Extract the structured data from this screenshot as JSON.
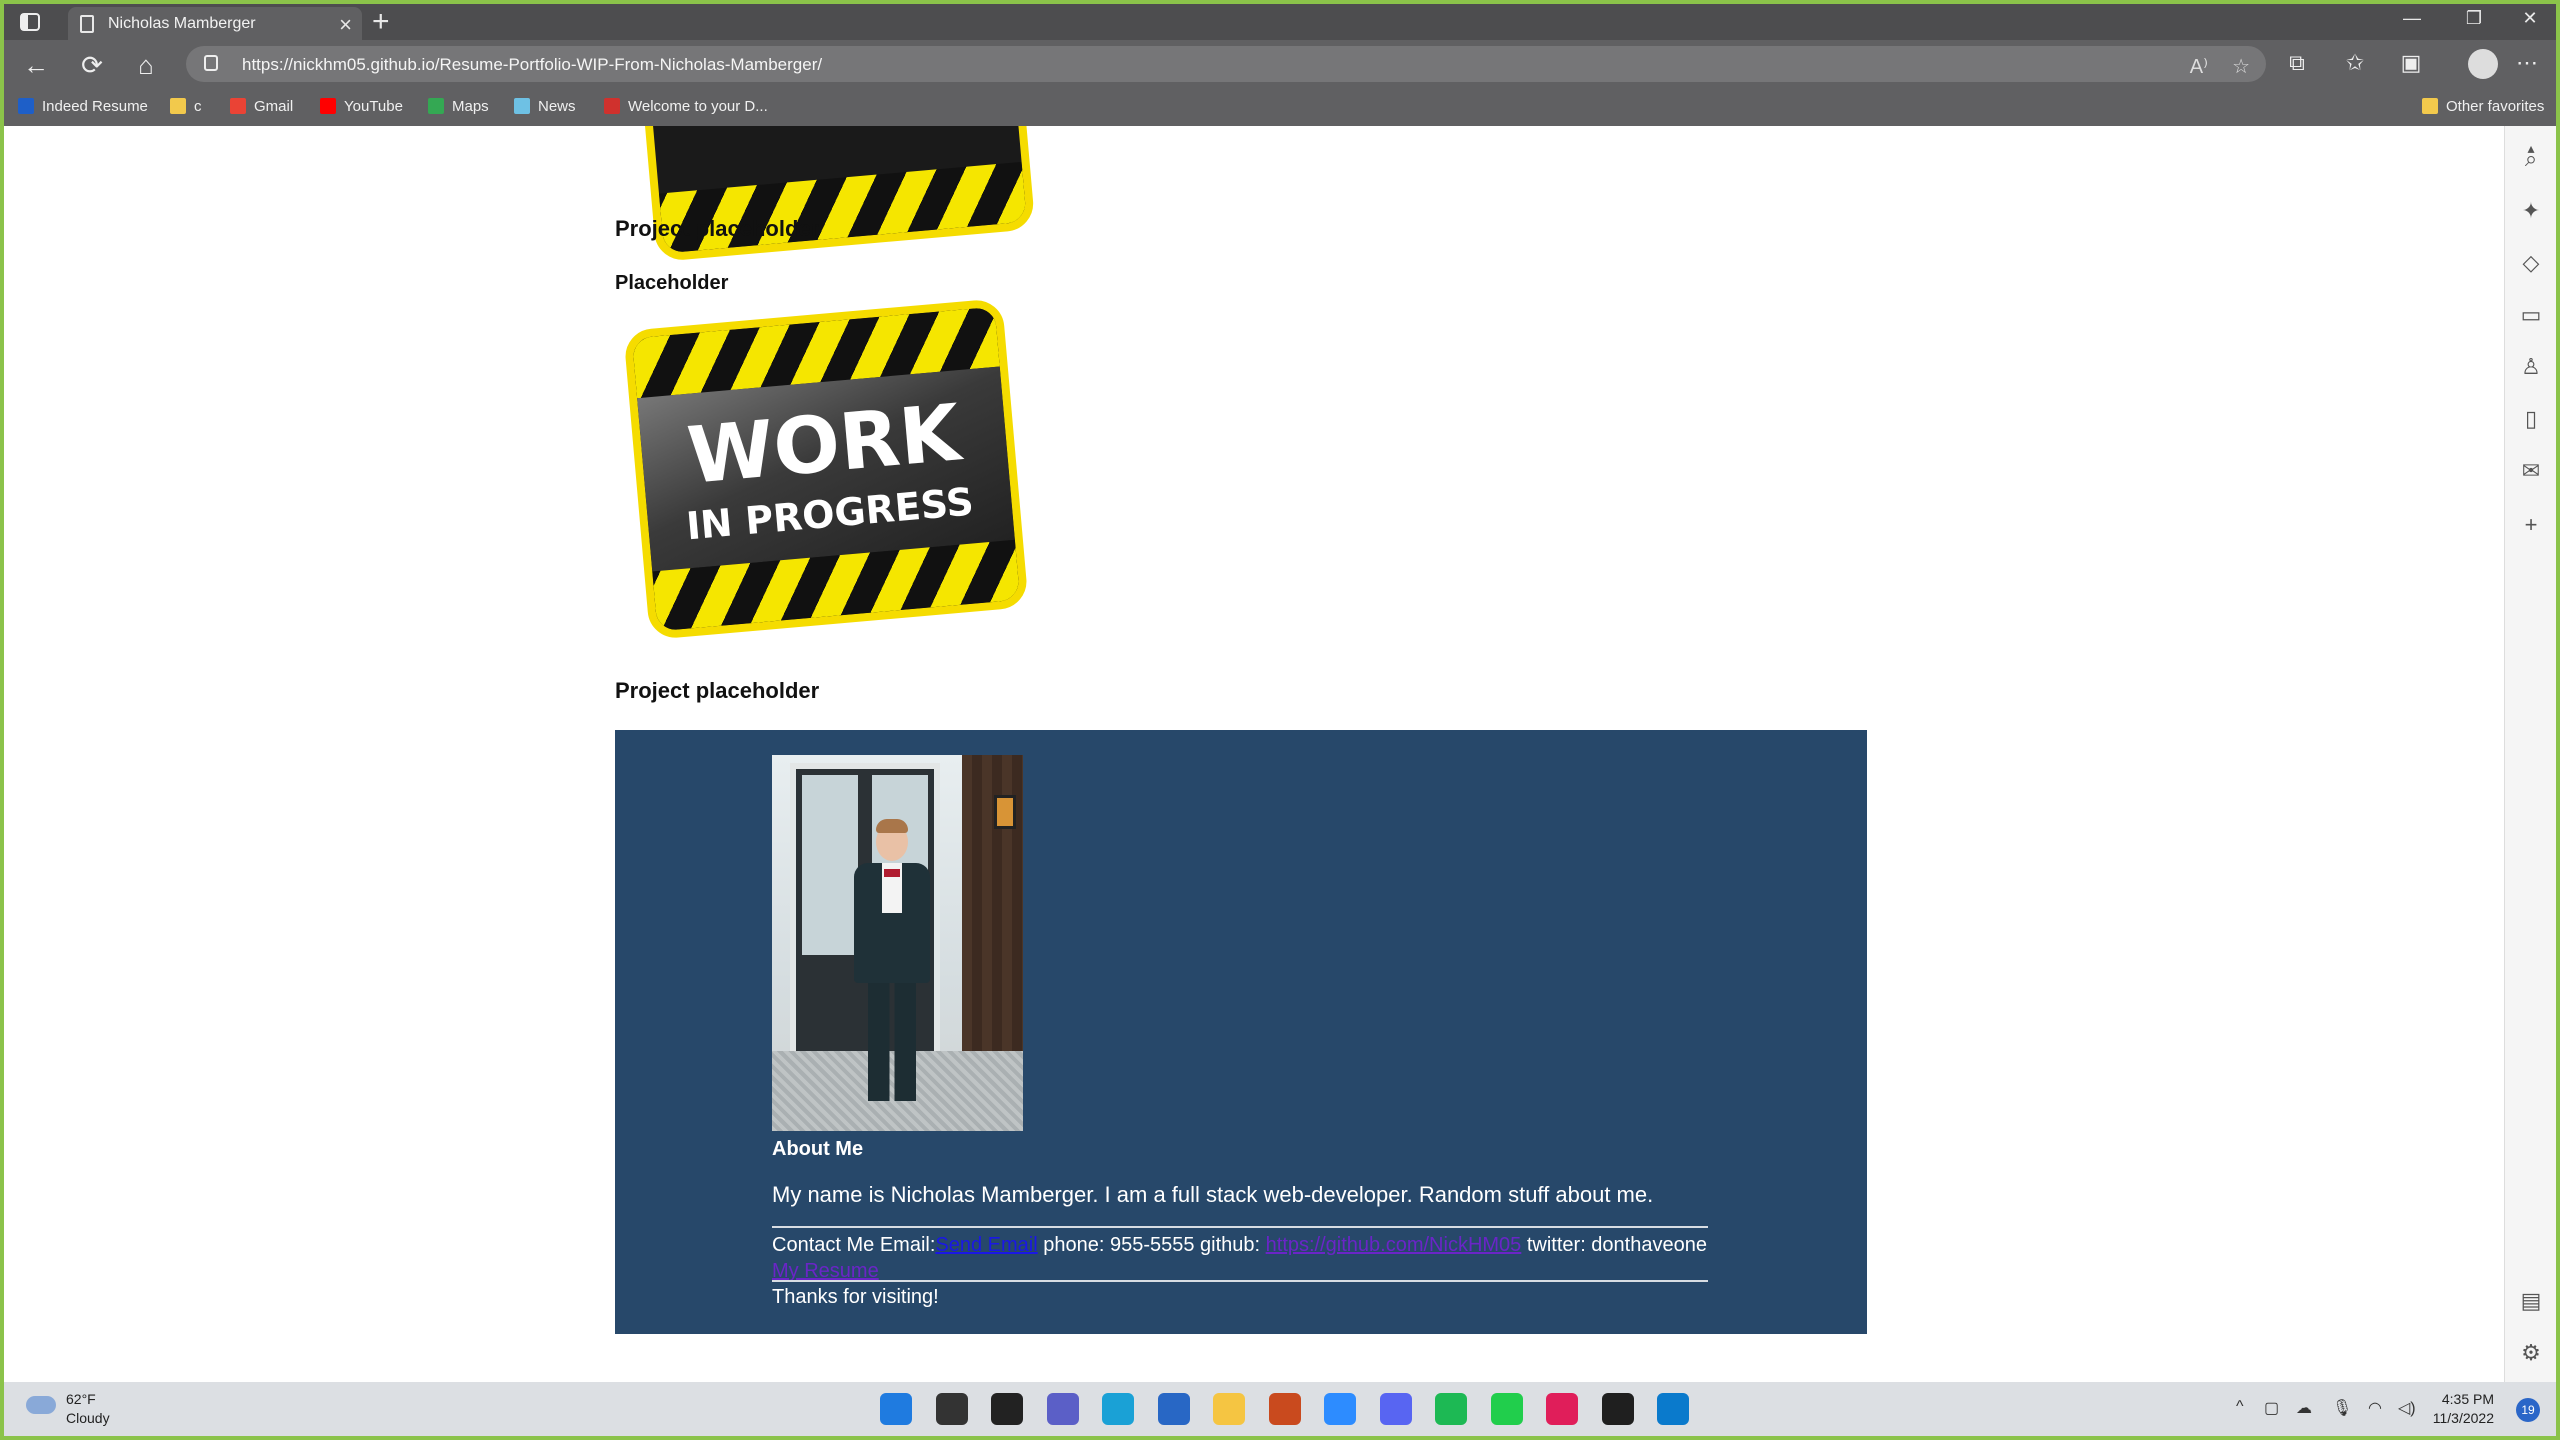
{
  "browser": {
    "tab_title": "Nicholas Mamberger",
    "url": "https://nickhm05.github.io/Resume-Portfolio-WIP-From-Nicholas-Mamberger/",
    "favorites": [
      {
        "label": "Indeed Resume",
        "icon": "indeed-icon",
        "color": "#1e5fc8"
      },
      {
        "label": "c",
        "icon": "folder-icon",
        "color": "#f2c94c"
      },
      {
        "label": "Gmail",
        "icon": "gmail-icon",
        "color": "#ea4335"
      },
      {
        "label": "YouTube",
        "icon": "youtube-icon",
        "color": "#ff0000"
      },
      {
        "label": "Maps",
        "icon": "maps-icon",
        "color": "#34a853"
      },
      {
        "label": "News",
        "icon": "news-icon",
        "color": "#6ec1e4"
      },
      {
        "label": "Welcome to your D...",
        "icon": "page-icon",
        "color": "#d0312d"
      }
    ],
    "other_favorites": "Other favorites"
  },
  "page": {
    "project_heading_1": "Project placeholder",
    "placeholder_heading": "Placeholder",
    "wip_word_1": "WORK",
    "wip_word_2": "IN PROGRESS",
    "project_heading_2": "Project placeholder",
    "about": {
      "title": "About Me",
      "text": "My name is Nicholas Mamberger. I am a full stack web-developer. Random stuff about me.",
      "contact_prefix": "Contact Me Email:",
      "email_link": "Send Email",
      "phone": " phone: 955-5555 github: ",
      "github_link": "https://github.com/NickHM05",
      "twitter": " twitter: donthaveone",
      "resume_link": "My Resume",
      "thanks": "Thanks for visiting!"
    }
  },
  "taskbar": {
    "temp": "62°F",
    "condition": "Cloudy",
    "time": "4:35 PM",
    "date": "11/3/2022",
    "notifications": "19",
    "apps": [
      {
        "name": "start-icon",
        "color": "#1f7be0"
      },
      {
        "name": "search-icon",
        "color": "#333333"
      },
      {
        "name": "task-view-icon",
        "color": "#222222"
      },
      {
        "name": "teams-chat-icon",
        "color": "#5b5fc7"
      },
      {
        "name": "edge-icon",
        "color": "#1aa1d6"
      },
      {
        "name": "store-icon",
        "color": "#2867c5"
      },
      {
        "name": "file-explorer-icon",
        "color": "#f5c542"
      },
      {
        "name": "app-icon",
        "color": "#c94a1e"
      },
      {
        "name": "zoom-icon",
        "color": "#2d8cff"
      },
      {
        "name": "discord-icon",
        "color": "#5865f2"
      },
      {
        "name": "spotify-icon",
        "color": "#1db954"
      },
      {
        "name": "robinhood-icon",
        "color": "#21ce4c"
      },
      {
        "name": "slack-icon",
        "color": "#e01e5a"
      },
      {
        "name": "terminal-icon",
        "color": "#1f1f1f"
      },
      {
        "name": "vscode-icon",
        "color": "#0a7acc"
      }
    ]
  }
}
